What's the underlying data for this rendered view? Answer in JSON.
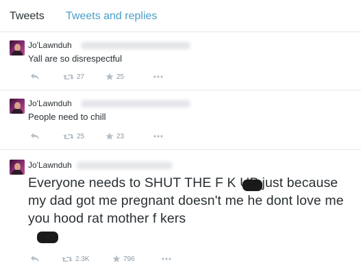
{
  "tabs": [
    {
      "label": "Tweets"
    },
    {
      "label": "Tweets and replies"
    }
  ],
  "tweets": [
    {
      "name": "Jo'Lawnduh",
      "text": "Yall are so disrespectful",
      "retweets": "27",
      "favorites": "25"
    },
    {
      "name": "Jo'Lawnduh",
      "text": "People need to chill",
      "retweets": "25",
      "favorites": "23"
    },
    {
      "name": "Jo'Lawnduh",
      "text": "Everyone needs to SHUT THE F   K UP just because my dad got me pregnant doesn't me he dont love me you hood rat mother f     kers",
      "retweets": "2.3K",
      "favorites": "796"
    }
  ],
  "icons": {
    "reply": "reply-icon",
    "retweet": "retweet-icon",
    "favorite": "star-icon",
    "more": "more-icon"
  },
  "colors": {
    "tab_active": "#292f33",
    "tab_link": "#4a9ec7",
    "icon": "#b4bec6",
    "count": "#8899a6",
    "divider": "#e1e8ed"
  }
}
